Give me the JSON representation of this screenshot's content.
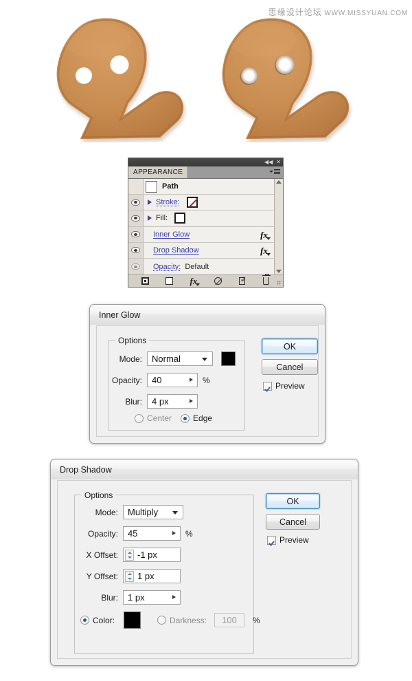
{
  "watermark": {
    "cn": "思缘设计论坛",
    "url": "WWW.MISSYUAN.COM"
  },
  "illustration": {
    "left_cookie_name": "gingerbread-man-plain-eyes",
    "right_cookie_name": "gingerbread-man-glow-eyes",
    "cookie_color": "#c98a4b",
    "cookie_edge_color": "#b5743c",
    "eye_color": "#ffffff"
  },
  "appearance_panel": {
    "tab_label": "APPEARANCE",
    "collapse_icon": "collapse-double-left-icon",
    "close_icon": "close-icon",
    "menu_icon": "panel-menu-icon",
    "rows": [
      {
        "name": "path",
        "label": "Path",
        "eye": false,
        "thumb": true,
        "fx": false,
        "value": ""
      },
      {
        "name": "stroke",
        "label": "Stroke:",
        "eye": true,
        "disclosure": true,
        "swatch": "none",
        "fx": false,
        "value": ""
      },
      {
        "name": "fill",
        "label": "Fill:",
        "eye": true,
        "disclosure": true,
        "swatch": "white",
        "fx": false,
        "value": ""
      },
      {
        "name": "inner-glow",
        "label": "Inner Glow",
        "eye": true,
        "disclosure": false,
        "fx": true,
        "value": ""
      },
      {
        "name": "drop-shadow",
        "label": "Drop Shadow",
        "eye": true,
        "disclosure": false,
        "fx": true,
        "value": ""
      },
      {
        "name": "opacity",
        "label": "Opacity:",
        "eye": true,
        "disclosure": false,
        "fx": false,
        "value": "Default"
      }
    ],
    "footer_buttons": [
      {
        "name": "add-new-stroke-button",
        "icon": "new-stroke-icon"
      },
      {
        "name": "add-new-fill-button",
        "icon": "new-fill-icon"
      },
      {
        "name": "add-new-effect-button",
        "icon": "fx-icon"
      },
      {
        "name": "clear-appearance-button",
        "icon": "no-symbol-icon"
      },
      {
        "name": "duplicate-item-button",
        "icon": "duplicate-icon"
      },
      {
        "name": "delete-item-button",
        "icon": "trash-icon"
      }
    ],
    "scroll_up_icon": "scroll-up-arrow-icon",
    "scroll_down_icon": "scroll-down-arrow-icon",
    "resize_grip": "resize-grip-icon"
  },
  "inner_glow_dialog": {
    "title": "Inner Glow",
    "group_label": "Options",
    "mode_label": "Mode:",
    "mode_value": "Normal",
    "mode_color": "#000000",
    "opacity_label": "Opacity:",
    "opacity_value": "40",
    "opacity_unit": "%",
    "blur_label": "Blur:",
    "blur_value": "4 px",
    "radio_center": "Center",
    "radio_edge": "Edge",
    "radio_selected": "Edge",
    "ok_label": "OK",
    "cancel_label": "Cancel",
    "preview_label": "Preview",
    "preview_checked": true
  },
  "drop_shadow_dialog": {
    "title": "Drop Shadow",
    "group_label": "Options",
    "mode_label": "Mode:",
    "mode_value": "Multiply",
    "opacity_label": "Opacity:",
    "opacity_value": "45",
    "opacity_unit": "%",
    "x_offset_label": "X Offset:",
    "x_offset_value": "-1 px",
    "y_offset_label": "Y Offset:",
    "y_offset_value": "1 px",
    "blur_label": "Blur:",
    "blur_value": "1 px",
    "color_label": "Color:",
    "color_value": "#000000",
    "darkness_label": "Darkness:",
    "darkness_value": "100",
    "darkness_unit": "%",
    "radio_selected": "Color",
    "ok_label": "OK",
    "cancel_label": "Cancel",
    "preview_label": "Preview",
    "preview_checked": true
  }
}
